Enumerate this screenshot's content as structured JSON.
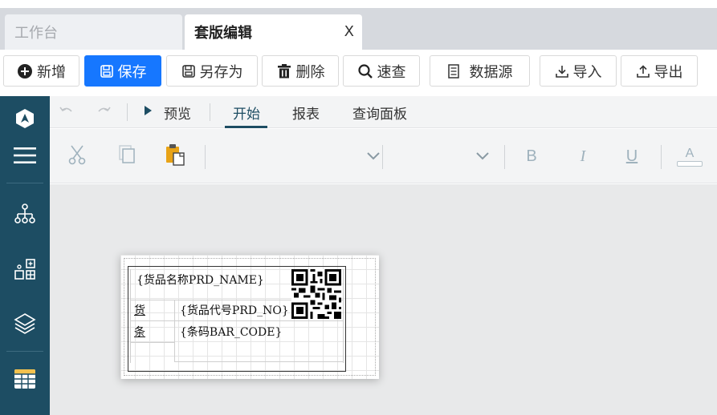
{
  "tabs": {
    "workbench": "工作台",
    "active": "套版编辑",
    "close": "X"
  },
  "toolbar": {
    "add": "新增",
    "save": "保存",
    "save_as": "另存为",
    "delete": "删除",
    "quick_search": "速查",
    "datasource": "数据源",
    "import": "导入",
    "export": "导出"
  },
  "ribbon": {
    "preview": "预览",
    "tabs": [
      "开始",
      "报表",
      "查询面板"
    ],
    "bold": "B",
    "italic": "I",
    "underline": "U",
    "font_color": "A"
  },
  "label": {
    "product_name": "{货品名称PRD_NAME}",
    "row1_label": "货",
    "product_no": "{货品代号PRD_NO}",
    "row2_label": "条",
    "barcode": "{条码BAR_CODE}"
  },
  "colors": {
    "sidebar": "#1d4d63",
    "primary": "#1677ff",
    "tab_bar": "#d6d9de",
    "canvas": "#e8e9ea"
  },
  "icons": [
    "plus-circle-icon",
    "save-icon",
    "trash-icon",
    "search-icon",
    "database-icon",
    "download-icon",
    "upload-icon",
    "logo-icon",
    "menu-icon",
    "hierarchy-icon",
    "components-icon",
    "layers-icon",
    "table-icon",
    "undo-icon",
    "redo-icon",
    "play-icon",
    "cut-icon",
    "copy-icon",
    "paste-icon",
    "chevron-down-icon",
    "qr-code-icon"
  ]
}
